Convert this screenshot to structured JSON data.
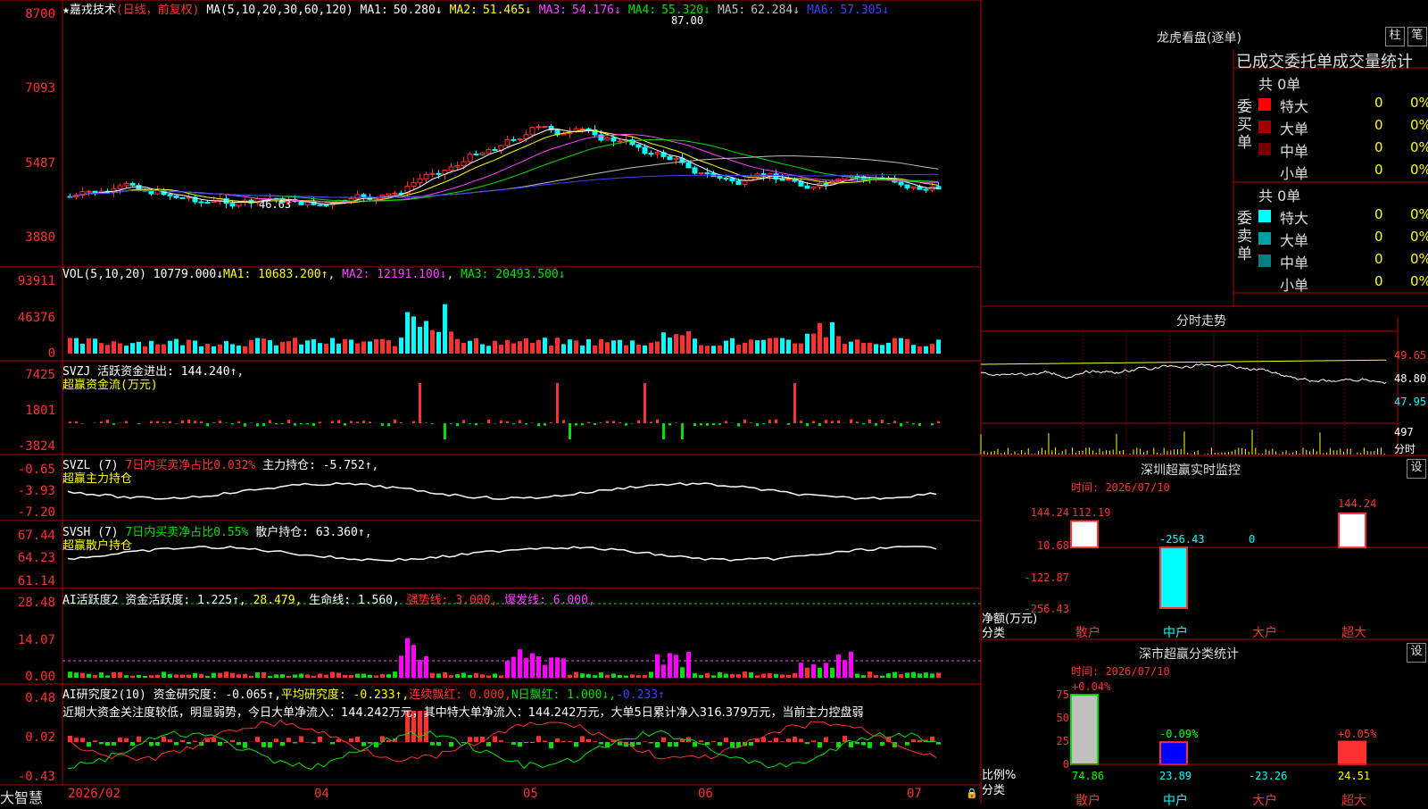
{
  "stock": {
    "title": "★嘉戎技术",
    "mode": "(日线，前复权)",
    "ma_label": "MA(5,10,20,30,60,120)",
    "ma_values": [
      {
        "label": "MA1:",
        "value": "50.280↓",
        "color": "#ffffff"
      },
      {
        "label": "MA2:",
        "value": "51.465↓",
        "color": "#ffff00"
      },
      {
        "label": "MA3:",
        "value": "54.176↓",
        "color": "#ff40ff"
      },
      {
        "label": "MA4:",
        "value": "55.320↓",
        "color": "#00e000"
      },
      {
        "label": "MA5:",
        "value": "62.284↓",
        "color": "#c0c0c0"
      },
      {
        "label": "MA6:",
        "value": "57.305↓",
        "color": "#4040ff"
      }
    ],
    "price_axis": [
      "8700",
      "7093",
      "5487",
      "3880"
    ],
    "high_mark": "87.00",
    "low_mark": "46.63"
  },
  "volume": {
    "header": "VOL(5,10,20)",
    "value": "10779.000↓",
    "ma1": "MA1: 10683.200↑",
    "ma2": "MA2: 12191.100↓",
    "ma3": "MA3: 20493.500↓",
    "axis": [
      "93911",
      "46376",
      "0"
    ]
  },
  "svzj": {
    "header": "SVZJ  活跃资金进出: 144.240↑,",
    "sub": "超赢资金流(万元)",
    "axis": [
      "7425",
      "1801",
      "-3824"
    ]
  },
  "svzl": {
    "header_a": "SVZL (7)",
    "header_b": "7日内买卖净占比0.032%",
    "header_c": "主力持仓: -5.752↑,",
    "sub": "超赢主力持仓",
    "axis": [
      "-0.65",
      "-3.93",
      "-7.20"
    ]
  },
  "svsh": {
    "header_a": "SVSH (7)",
    "header_b": "7日内买卖净占比0.55%",
    "header_c": "散户持仓: 63.360↑,",
    "sub": "超赢散户持仓",
    "axis": [
      "67.44",
      "64.23",
      "61.14"
    ]
  },
  "ai_active": {
    "header_a": "AI活跃度2",
    "header_b": "资金活跃度: 1.225↑,",
    "header_c": "28.479,",
    "header_d": "生命线: 1.560,",
    "header_e": "强势线: 3.000,",
    "header_f": "爆发线: 6.000,",
    "axis": [
      "28.48",
      "14.07",
      "0.00"
    ]
  },
  "ai_research": {
    "header_a": "AI研究度2(10)",
    "header_b": "资金研究度: -0.065↑,",
    "header_c": "平均研究度: -0.233↑,",
    "header_d": "连续飘红: 0.000,",
    "header_e": "N日飘红: 1.000↓,",
    "header_f": "-0.233↑",
    "comment": "近期大资金关注度较低，明显弱势，今日大单净流入：144.242万元，其中特大单净流入：144.242万元，大单5日累计净入316.379万元，当前主力控盘弱",
    "axis": [
      "0.48",
      "0.02",
      "-0.43"
    ]
  },
  "bottom_bar": {
    "brand": "大智慧",
    "dates": [
      "2026/02",
      "04",
      "05",
      "06",
      "07"
    ]
  },
  "right_panel": {
    "lhb_title": "龙虎看盘(逐单)",
    "btn_zhu": "柱",
    "btn_bi": "笔",
    "tabs_title": "已成交委托单成交量统计",
    "buy_side_label": "委买单",
    "sell_side_label": "委卖单",
    "buy_total": "共 0单",
    "sell_total": "共 0单",
    "buy_rows": [
      {
        "label": "特大",
        "value": "0",
        "pct": "0%",
        "color": "#ff0000"
      },
      {
        "label": "大单",
        "value": "0",
        "pct": "0%",
        "color": "#a00000"
      },
      {
        "label": "中单",
        "value": "0",
        "pct": "0%",
        "color": "#700000"
      },
      {
        "label": "小单",
        "value": "0",
        "pct": "0%",
        "color": "#000000"
      }
    ],
    "sell_rows": [
      {
        "label": "特大",
        "value": "0",
        "pct": "0%",
        "color": "#00ffff"
      },
      {
        "label": "大单",
        "value": "0",
        "pct": "0%",
        "color": "#00a0a0"
      },
      {
        "label": "中单",
        "value": "0",
        "pct": "0%",
        "color": "#008080"
      },
      {
        "label": "小单",
        "value": "0",
        "pct": "0%",
        "color": "#000000"
      }
    ],
    "intraday_title": "分时走势",
    "intraday_axis": [
      "49.65",
      "48.80",
      "47.95"
    ],
    "intraday_vol": "497",
    "intraday_vol_label": "分时",
    "sz_monitor_title": "深圳超赢实时监控",
    "sz_btn": "设",
    "sz_time": "时间: 2026/07/10",
    "sz_axis": [
      "144.24",
      "10.68",
      "-122.87",
      "-256.43"
    ],
    "sz_values": [
      "112.19",
      "-256.43",
      "0",
      "144.24"
    ],
    "sz_ylabel": "净额(万元)",
    "sz_xlabel": "分类",
    "categories": [
      "散户",
      "中户",
      "大户",
      "超大"
    ],
    "class_title": "深市超赢分类统计",
    "class_btn": "设",
    "class_time": "时间: 2026/07/10",
    "class_axis": [
      "75",
      "50",
      "25",
      "0"
    ],
    "class_top": [
      "+0.04%",
      "-0.09%",
      "",
      "+0.05%"
    ],
    "class_values": [
      "74.86",
      "23.89",
      "-23.26",
      "24.51"
    ],
    "class_ylabel": "比例%",
    "class_xlabel": "分类"
  },
  "chart_data": {
    "type": "bar",
    "categories": [
      "散户",
      "中户",
      "大户",
      "超大"
    ],
    "series": [
      {
        "name": "净额(万元)",
        "values": [
          112.19,
          -256.43,
          0,
          144.24
        ]
      }
    ],
    "ylim": [
      -256.43,
      144.24
    ]
  }
}
